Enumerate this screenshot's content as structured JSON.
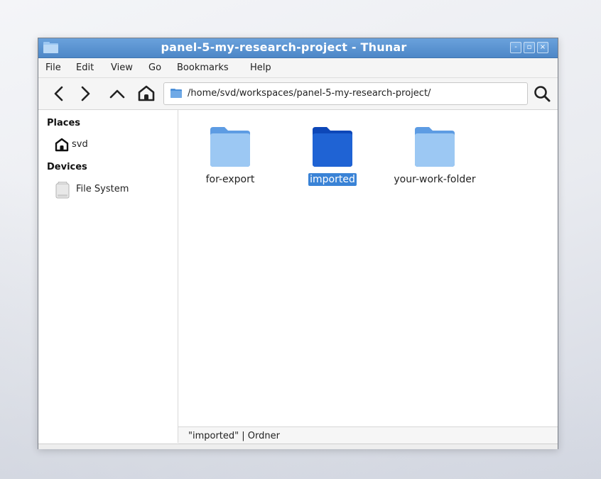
{
  "window": {
    "title": "panel-5-my-research-project - Thunar",
    "controls": {
      "minimize": "-",
      "maximize": "▫",
      "close": "×"
    }
  },
  "menubar": {
    "items": [
      "File",
      "Edit",
      "View",
      "Go",
      "Bookmarks",
      "Help"
    ]
  },
  "toolbar": {
    "back_icon": "chevron-left-icon",
    "forward_icon": "chevron-right-icon",
    "up_icon": "chevron-up-icon",
    "home_icon": "home-icon",
    "search_icon": "search-icon"
  },
  "location": {
    "path": "/home/svd/workspaces/panel-5-my-research-project/"
  },
  "sidebar": {
    "sections": [
      {
        "heading": "Places",
        "items": [
          {
            "label": "svd",
            "icon": "home-icon"
          }
        ]
      },
      {
        "heading": "Devices",
        "items": [
          {
            "label": "File System",
            "icon": "drive-icon"
          }
        ]
      }
    ]
  },
  "files": [
    {
      "name": "for-export",
      "selected": false
    },
    {
      "name": "imported",
      "selected": true
    },
    {
      "name": "your-work-folder",
      "selected": false
    }
  ],
  "status": {
    "text": "\"imported\"  |  Ordner"
  },
  "colors": {
    "titlebar": "#5a93d0",
    "folder_light": "#8fbdef",
    "folder_selected": "#1f63d4",
    "selection": "#3a83d6"
  }
}
